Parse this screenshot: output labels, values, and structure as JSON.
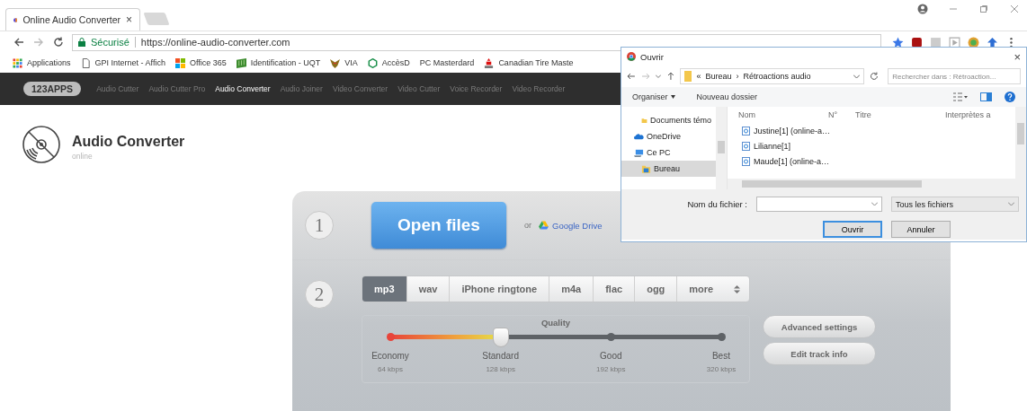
{
  "browser": {
    "tab": {
      "title": "Online Audio Converter",
      "close": "×"
    },
    "address": {
      "secure_label": "Sécurisé",
      "url": "https://online-audio-converter.com"
    },
    "bookmarks": [
      {
        "label": "Applications",
        "kind": "apps"
      },
      {
        "label": "GPI Internet - Affich",
        "kind": "page"
      },
      {
        "label": "Office 365",
        "kind": "windows"
      },
      {
        "label": "Identification - UQT",
        "kind": "flag"
      },
      {
        "label": "VIA",
        "kind": "bird"
      },
      {
        "label": "AccèsD",
        "kind": "hexagon"
      },
      {
        "label": "PC Masterdard",
        "kind": "blank"
      },
      {
        "label": "Canadian Tire Maste",
        "kind": "logo"
      }
    ]
  },
  "site_nav": {
    "logo": "123APPS",
    "links": [
      {
        "label": "Audio Cutter",
        "selected": false
      },
      {
        "label": "Audio Cutter Pro",
        "selected": false
      },
      {
        "label": "Audio Converter",
        "selected": true
      },
      {
        "label": "Audio Joiner",
        "selected": false
      },
      {
        "label": "Video Converter",
        "selected": false
      },
      {
        "label": "Video Cutter",
        "selected": false
      },
      {
        "label": "Voice Recorder",
        "selected": false
      },
      {
        "label": "Video Recorder",
        "selected": false
      }
    ]
  },
  "app_header": {
    "title": "Audio Converter",
    "subtitle": "online"
  },
  "step1": {
    "number": "1",
    "open_button": "Open files",
    "or": "or",
    "drive_link": "Google Drive"
  },
  "step2": {
    "number": "2",
    "formats": [
      {
        "label": "mp3",
        "selected": true
      },
      {
        "label": "wav",
        "selected": false
      },
      {
        "label": "iPhone ringtone",
        "selected": false
      },
      {
        "label": "m4a",
        "selected": false
      },
      {
        "label": "flac",
        "selected": false
      },
      {
        "label": "ogg",
        "selected": false
      }
    ],
    "more": "more",
    "quality": {
      "title": "Quality",
      "level": 0.333,
      "stops": [
        {
          "label": "Economy",
          "bitrate": "64 kbps"
        },
        {
          "label": "Standard",
          "bitrate": "128 kbps"
        },
        {
          "label": "Good",
          "bitrate": "192 kbps"
        },
        {
          "label": "Best",
          "bitrate": "320 kbps"
        }
      ]
    },
    "buttons": [
      "Advanced settings",
      "Edit track info"
    ]
  },
  "dialog": {
    "title": "Ouvrir",
    "close": "×",
    "path_prefix": "«",
    "path": [
      "Bureau",
      "Rétroactions audio"
    ],
    "path_separator": "›",
    "search": {
      "placeholder": "Rechercher dans : Rétroaction..."
    },
    "toolbar": {
      "organize": "Organiser",
      "new_folder": "Nouveau dossier"
    },
    "tree": [
      {
        "label": "Documents témo",
        "kind": "folder",
        "selected": false
      },
      {
        "label": "OneDrive",
        "kind": "cloud",
        "selected": false
      },
      {
        "label": "Ce PC",
        "kind": "pc",
        "selected": false,
        "children": [
          {
            "label": "Bureau",
            "kind": "desktop",
            "selected": true
          }
        ]
      }
    ],
    "columns": [
      "Nom",
      "N°",
      "Titre",
      "Interprètes a"
    ],
    "files": [
      "Justine[1] (online-a…",
      "Lilianne[1]",
      "Maude[1] (online-a…"
    ],
    "filename_label": "Nom du fichier :",
    "file_type": "Tous les fichiers",
    "buttons": [
      "Ouvrir",
      "Annuler"
    ]
  }
}
